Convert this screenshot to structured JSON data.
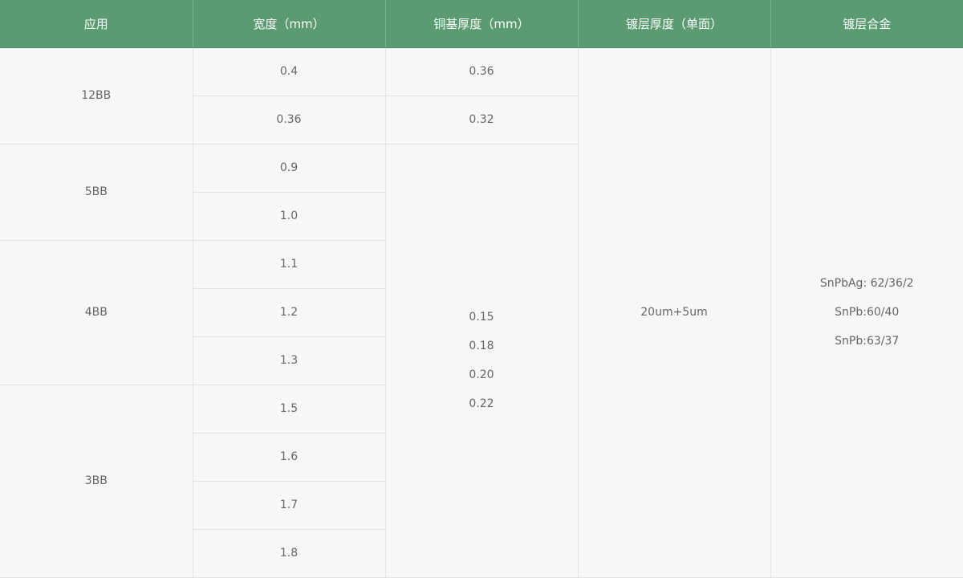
{
  "headers": [
    "应用",
    "宽度（mm）",
    "铜基厚度（mm）",
    "镀层厚度（单面）",
    "镀层合金"
  ],
  "applications": [
    "12BB",
    "5BB",
    "4BB",
    "3BB"
  ],
  "widths": [
    "0.4",
    "0.36",
    "0.9",
    "1.0",
    "1.1",
    "1.2",
    "1.3",
    "1.5",
    "1.6",
    "1.7",
    "1.8"
  ],
  "copper_thickness": {
    "row1": "0.36",
    "row2": "0.32",
    "rest": [
      "0.15",
      "0.18",
      "0.20",
      "0.22"
    ]
  },
  "coating_thickness": "20um+5um",
  "alloys": [
    "SnPbAg: 62/36/2",
    "SnPb:60/40",
    "SnPb:63/37"
  ]
}
